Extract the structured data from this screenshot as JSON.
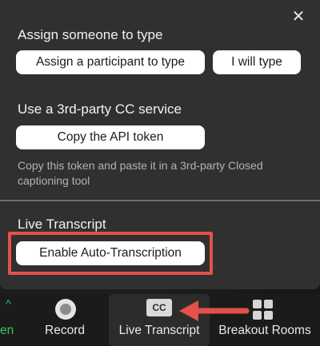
{
  "panel": {
    "close_glyph": "✕",
    "assign_section": {
      "title": "Assign someone to type",
      "assign_participant_label": "Assign a participant to type",
      "i_will_type_label": "I will type"
    },
    "third_party_section": {
      "title": "Use a 3rd-party CC service",
      "copy_api_label": "Copy the API token",
      "hint": "Copy this token and paste it in a 3rd-party Closed captioning tool"
    },
    "live_transcript_section": {
      "title": "Live Transcript",
      "enable_label": "Enable Auto-Transcription"
    }
  },
  "toolbar": {
    "partial_item": {
      "label": "en",
      "caret": "^"
    },
    "record": {
      "label": "Record",
      "icon": "record-icon"
    },
    "live_transcript": {
      "label": "Live Transcript",
      "icon_text": "CC"
    },
    "breakout_rooms": {
      "label": "Breakout Rooms",
      "icon": "grid-icon"
    }
  },
  "annotation": {
    "color": "#e4514a"
  }
}
